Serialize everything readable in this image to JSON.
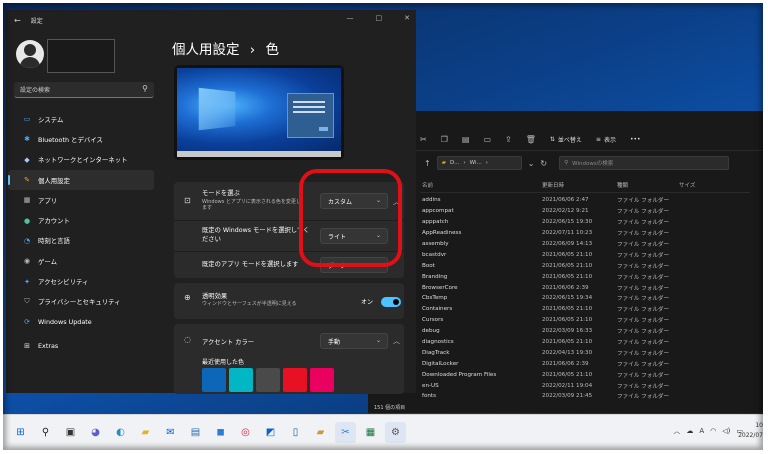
{
  "settings": {
    "window_title": "設定",
    "search_placeholder": "設定の検索",
    "nav": [
      {
        "label": "システム",
        "icon": "monitor-icon",
        "glyph": "▭",
        "color": "#4aa8ff"
      },
      {
        "label": "Bluetooth とデバイス",
        "icon": "bluetooth-icon",
        "glyph": "✱",
        "color": "#4aa8ff"
      },
      {
        "label": "ネットワークとインターネット",
        "icon": "wifi-icon",
        "glyph": "◆",
        "color": "#aac8ff"
      },
      {
        "label": "個人用設定",
        "icon": "brush-icon",
        "glyph": "✎",
        "color": "#f0a030"
      },
      {
        "label": "アプリ",
        "icon": "apps-icon",
        "glyph": "▦",
        "color": "#bbb"
      },
      {
        "label": "アカウント",
        "icon": "account-icon",
        "glyph": "●",
        "color": "#4fc3a1"
      },
      {
        "label": "時刻と言語",
        "icon": "clock-globe-icon",
        "glyph": "◔",
        "color": "#4aa8ff"
      },
      {
        "label": "ゲーム",
        "icon": "gamepad-icon",
        "glyph": "◉",
        "color": "#bbb"
      },
      {
        "label": "アクセシビリティ",
        "icon": "accessibility-icon",
        "glyph": "✦",
        "color": "#4aa8ff"
      },
      {
        "label": "プライバシーとセキュリティ",
        "icon": "shield-icon",
        "glyph": "⛉",
        "color": "#aaa"
      },
      {
        "label": "Windows Update",
        "icon": "update-icon",
        "glyph": "⟳",
        "color": "#4aa8ff"
      },
      {
        "label": "Extras",
        "icon": "extras-icon",
        "glyph": "⊞",
        "color": "#ddd"
      }
    ],
    "breadcrumb_parent": "個人用設定",
    "breadcrumb_sep": "›",
    "breadcrumb_current": "色",
    "mode": {
      "title": "モードを選ぶ",
      "desc_line1": "Windows とアプリに表示される色を変更し",
      "desc_line2": "ます",
      "value": "カスタム"
    },
    "windows_mode": {
      "label_line1": "既定の Windows モードを選択してく",
      "label_line2": "ださい",
      "value": "ライト"
    },
    "app_mode": {
      "label": "既定のアプリ モードを選択します",
      "value": "ダーク"
    },
    "transparency": {
      "title": "透明効果",
      "desc": "ウィンドウとサーフェスが半透明に見える",
      "state": "オン"
    },
    "accent": {
      "title": "アクセント カラー",
      "value": "手動",
      "recent_label": "最近使用した色",
      "recent_colors": [
        "#0c67b8",
        "#00b7c3",
        "#4a4a4a",
        "#e81123",
        "#ea005e"
      ]
    }
  },
  "explorer": {
    "toolbar": {
      "sort": "並べ替え",
      "view": "表示",
      "more": "•••"
    },
    "address": {
      "part1": "D...",
      "part2": "Wi..."
    },
    "search_placeholder": "Windowsの検索",
    "columns": [
      "名前",
      "更新日時",
      "種類",
      "サイズ"
    ],
    "files": [
      [
        "addins",
        "2021/06/06 2:47",
        "ファイル フォルダー"
      ],
      [
        "appcompat",
        "2022/02/12 9:21",
        "ファイル フォルダー"
      ],
      [
        "apppatch",
        "2022/06/15 19:30",
        "ファイル フォルダー"
      ],
      [
        "AppReadiness",
        "2022/07/11 10:23",
        "ファイル フォルダー"
      ],
      [
        "assembly",
        "2022/06/09 14:13",
        "ファイル フォルダー"
      ],
      [
        "bcastdvr",
        "2021/06/05 21:10",
        "ファイル フォルダー"
      ],
      [
        "Boot",
        "2021/06/05 21:10",
        "ファイル フォルダー"
      ],
      [
        "Branding",
        "2021/06/05 21:10",
        "ファイル フォルダー"
      ],
      [
        "BrowserCore",
        "2021/06/06 2:39",
        "ファイル フォルダー"
      ],
      [
        "CbsTemp",
        "2022/06/15 19:34",
        "ファイル フォルダー"
      ],
      [
        "Containers",
        "2021/06/05 21:10",
        "ファイル フォルダー"
      ],
      [
        "Cursors",
        "2021/06/05 21:10",
        "ファイル フォルダー"
      ],
      [
        "debug",
        "2022/03/09 16:33",
        "ファイル フォルダー"
      ],
      [
        "diagnostics",
        "2021/06/05 21:10",
        "ファイル フォルダー"
      ],
      [
        "DiagTrack",
        "2022/04/13 19:30",
        "ファイル フォルダー"
      ],
      [
        "DigitalLocker",
        "2021/06/06 2:39",
        "ファイル フォルダー"
      ],
      [
        "Downloaded Program Files",
        "2021/06/05 21:10",
        "ファイル フォルダー"
      ],
      [
        "en-US",
        "2022/02/11 19:04",
        "ファイル フォルダー"
      ],
      [
        "fonts",
        "2022/03/09 21:45",
        "ファイル フォルダー"
      ]
    ],
    "status": "151 個の項目"
  },
  "taskbar": {
    "icons": [
      {
        "name": "start-icon",
        "glyph": "⊞",
        "color": "#0a64c8",
        "bg": "transparent"
      },
      {
        "name": "search-icon",
        "glyph": "⚲",
        "color": "#222",
        "bg": "transparent"
      },
      {
        "name": "task-view-icon",
        "glyph": "▣",
        "color": "#333",
        "bg": "transparent"
      },
      {
        "name": "chat-icon",
        "glyph": "◕",
        "color": "#5b5fc7",
        "bg": "transparent"
      },
      {
        "name": "edge-icon",
        "glyph": "◐",
        "color": "#1e90c8",
        "bg": "transparent"
      },
      {
        "name": "file-explorer-icon",
        "glyph": "▰",
        "color": "#e8b020",
        "bg": "transparent"
      },
      {
        "name": "mail-icon",
        "glyph": "✉",
        "color": "#0a64c8",
        "bg": "transparent"
      },
      {
        "name": "store-icon",
        "glyph": "▤",
        "color": "#2b6cb0",
        "bg": "transparent"
      },
      {
        "name": "app-icon-1",
        "glyph": "◼",
        "color": "#2a7fd4",
        "bg": "transparent"
      },
      {
        "name": "chrome-icon",
        "glyph": "◎",
        "color": "#d23",
        "bg": "transparent"
      },
      {
        "name": "outlook-icon",
        "glyph": "◩",
        "color": "#0a64c8",
        "bg": "transparent"
      },
      {
        "name": "word-doc-icon",
        "glyph": "▯",
        "color": "#2b579a",
        "bg": "transparent"
      },
      {
        "name": "folder-icon",
        "glyph": "▰",
        "color": "#c99a3a",
        "bg": "transparent"
      },
      {
        "name": "snipping-icon",
        "glyph": "✂",
        "color": "#2b7cd3",
        "bg": "#dde6f2"
      },
      {
        "name": "excel-icon",
        "glyph": "▦",
        "color": "#1d7144",
        "bg": "transparent"
      },
      {
        "name": "settings-gear-icon",
        "glyph": "⚙",
        "color": "#555",
        "bg": "#dde6f2"
      }
    ],
    "time": "10",
    "date": "2022/07"
  }
}
